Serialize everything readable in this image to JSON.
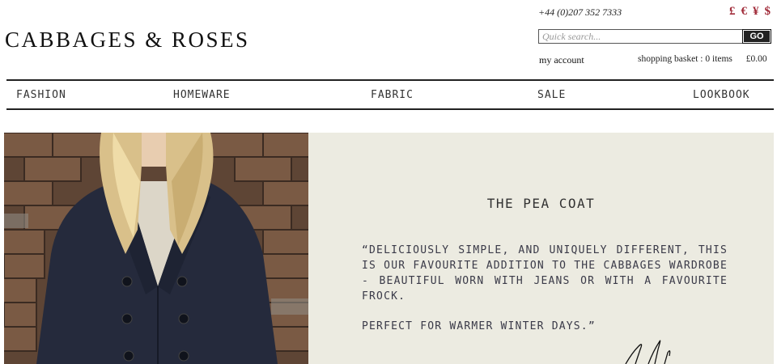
{
  "header": {
    "logo": "CABBAGES & ROSES",
    "phone": "+44 (0)207 352 7333",
    "currencies": [
      "£",
      "€",
      "¥",
      "$"
    ],
    "currency_color": "#a02a38",
    "search": {
      "placeholder": "Quick search...",
      "button": "GO"
    },
    "account_link": "my account",
    "basket": {
      "label": "shopping basket : 0 items",
      "total": "£0.00"
    }
  },
  "nav": {
    "items": [
      {
        "label": "FASHION"
      },
      {
        "label": "HOMEWARE"
      },
      {
        "label": "FABRIC"
      },
      {
        "label": "SALE"
      },
      {
        "label": "LOOKBOOK"
      }
    ]
  },
  "hero": {
    "title": "THE PEA COAT",
    "quote": "“DELICIOUSLY SIMPLE, AND UNIQUELY DIFFERENT, THIS IS OUR FAVOURITE  ADDITION TO THE CABBAGES WARDROBE - BEAUTIFUL WORN WITH JEANS  OR WITH A FAVOURITE FROCK.",
    "quote_end": "PERFECT FOR WARMER WINTER DAYS.”",
    "panel_color": "#ecebe1",
    "photo_icon": "model-in-navy-pea-coat-image",
    "signature_icon": "handwritten-signature-icon"
  }
}
